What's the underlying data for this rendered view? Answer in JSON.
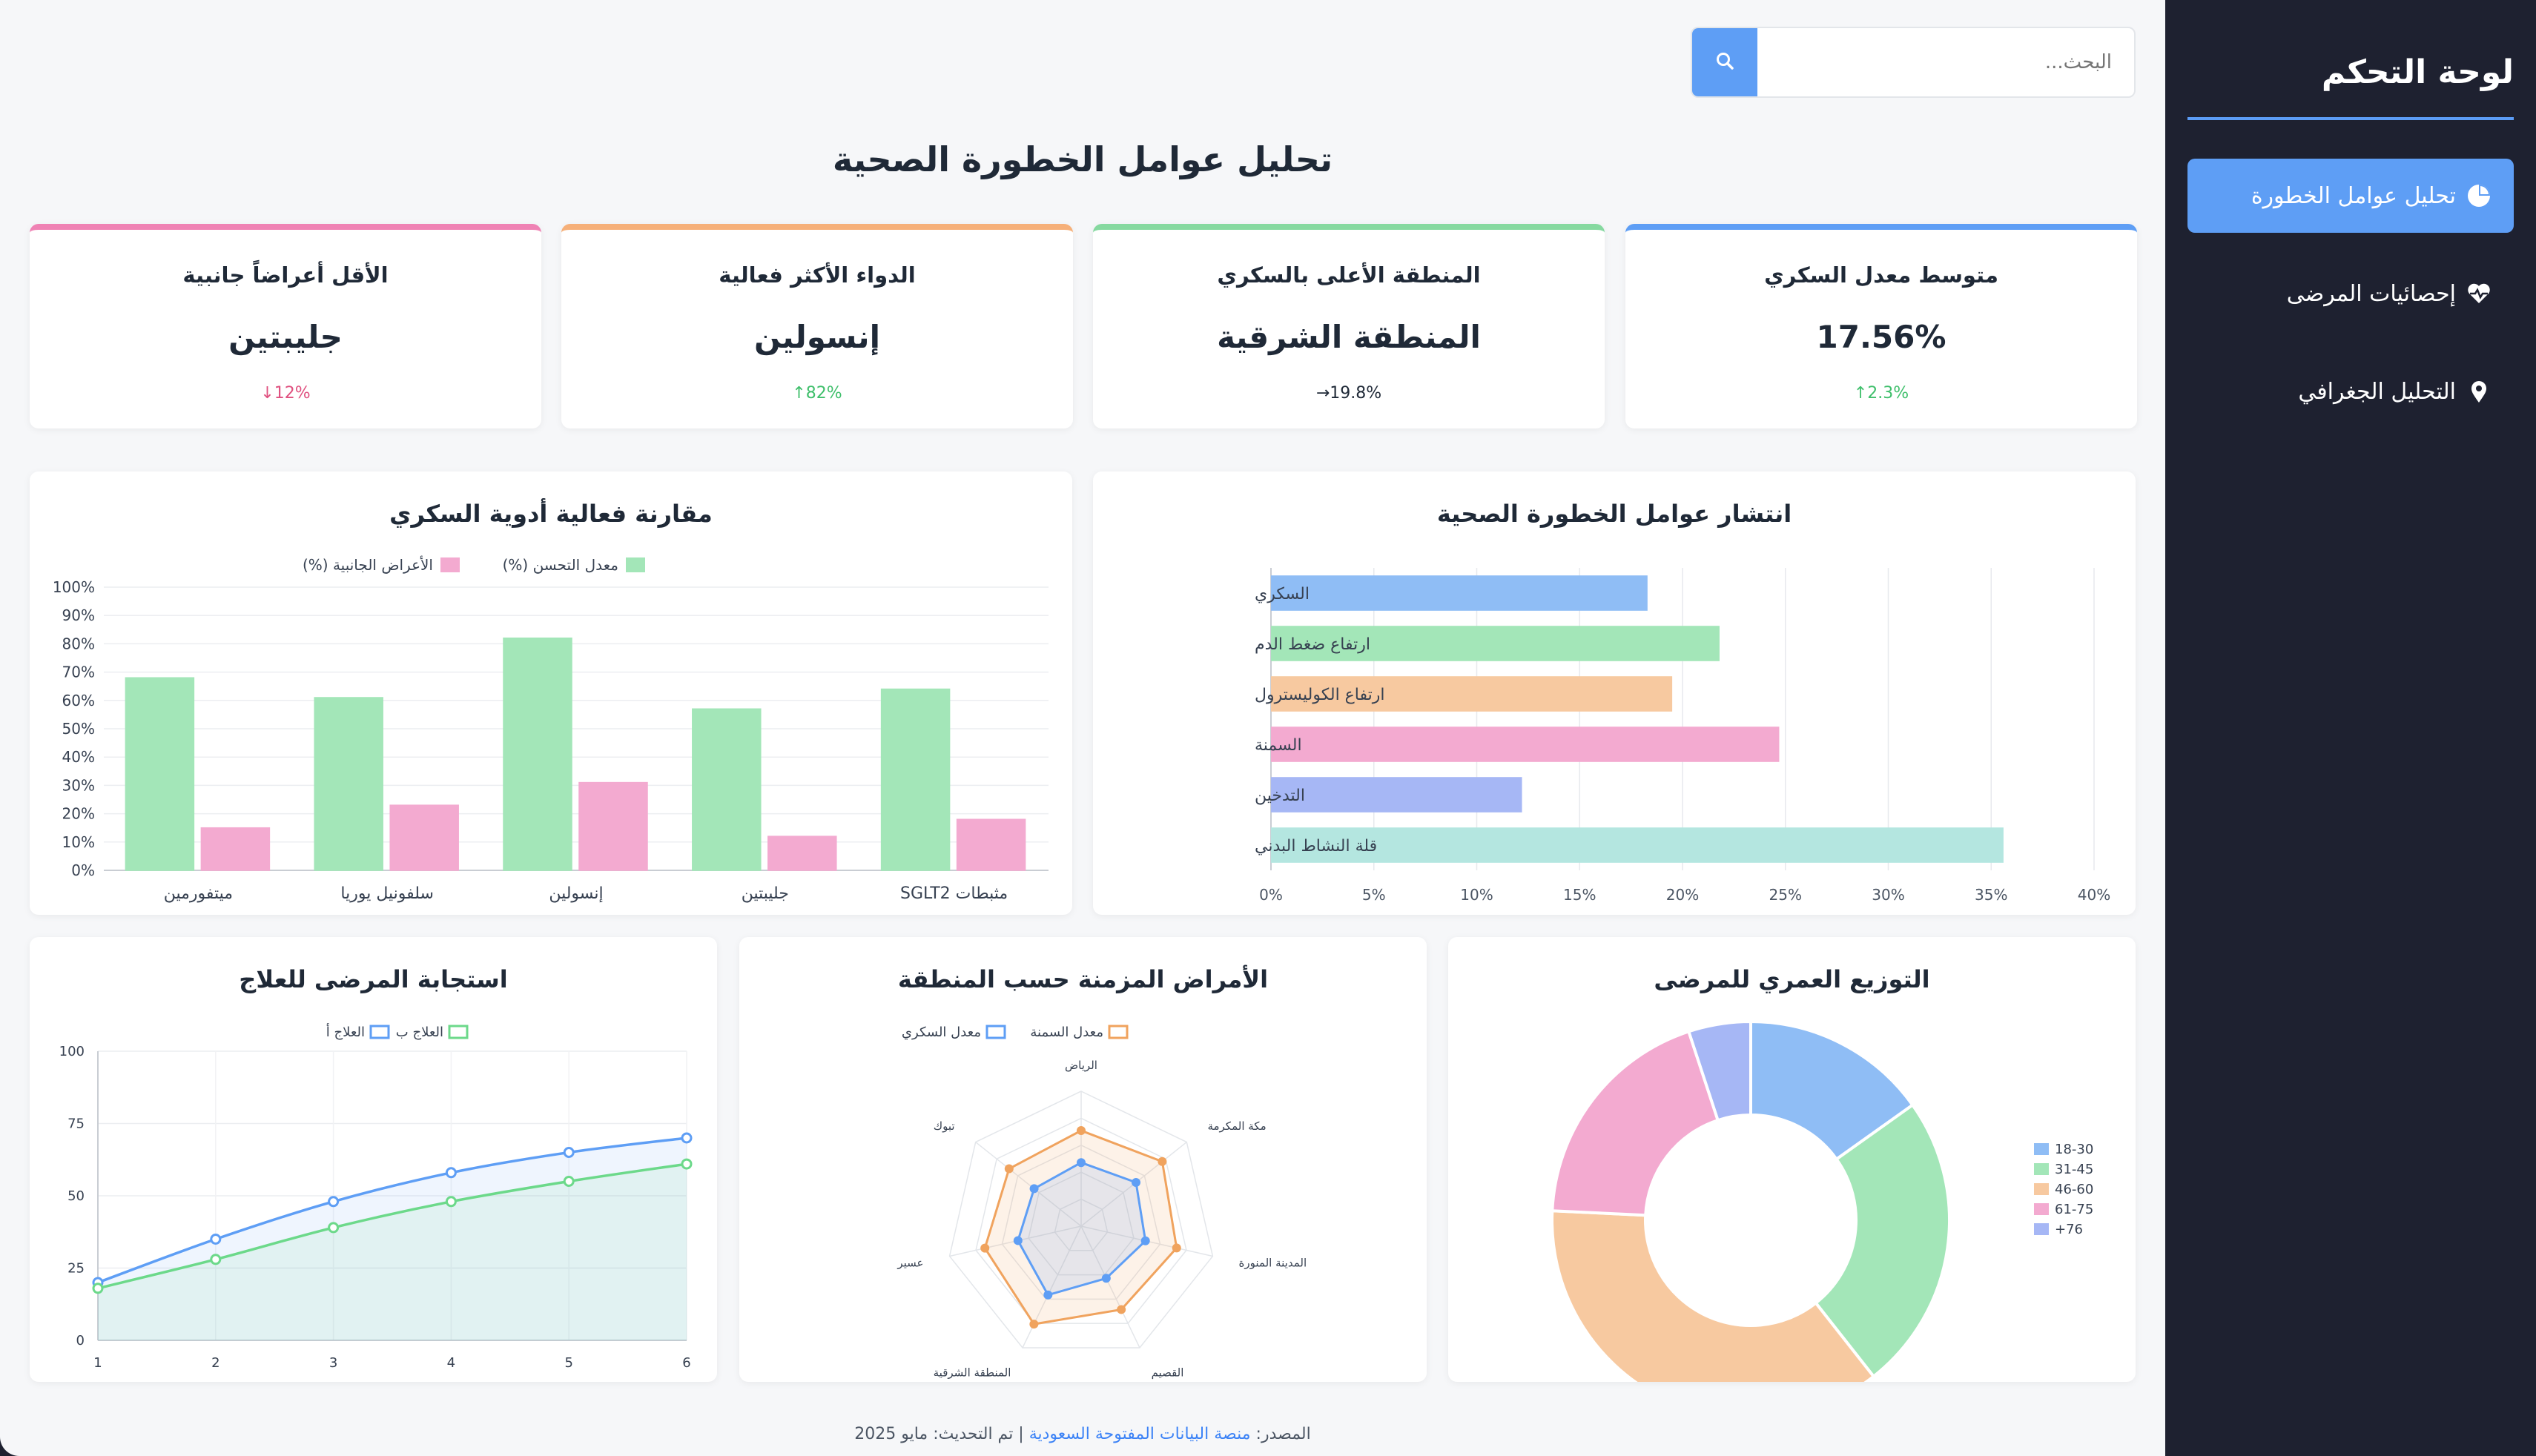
{
  "sidebar": {
    "title": "لوحة التحكم",
    "items": [
      {
        "label": "تحليل عوامل الخطورة",
        "icon": "pie-chart-icon",
        "active": true
      },
      {
        "label": "إحصائيات المرضى",
        "icon": "heartbeat-icon",
        "active": false
      },
      {
        "label": "التحليل الجغرافي",
        "icon": "map-marker-icon",
        "active": false
      }
    ]
  },
  "search": {
    "placeholder": "البحث..."
  },
  "page": {
    "title": "تحليل عوامل الخطورة الصحية"
  },
  "kpis": [
    {
      "title": "متوسط معدل السكري",
      "value": "17.56%",
      "change": "2.3%",
      "trend": "up",
      "color": "#5e9ef5",
      "trend_color": "#3fbf6b"
    },
    {
      "title": "المنطقة الأعلى بالسكري",
      "value": "المنطقة الشرقية",
      "change": "19.8%",
      "trend": "right",
      "color": "#86d9a0",
      "trend_color": "#1f2937"
    },
    {
      "title": "الدواء الأكثر فعالية",
      "value": "إنسولين",
      "change": "82%",
      "trend": "up",
      "color": "#f6b079",
      "trend_color": "#3fbf6b"
    },
    {
      "title": "الأقل أعراضاً جانبية",
      "value": "جليبتين",
      "change": "12%",
      "trend": "down",
      "color": "#ef82b4",
      "trend_color": "#e0507f"
    }
  ],
  "colors": {
    "blue": "#8fbdf5",
    "green": "#a3e6b8",
    "orange": "#f7c9a0",
    "pink": "#f3aad0",
    "indigo": "#a6b7f5",
    "teal": "#b4e6e0"
  },
  "chart_data": [
    {
      "id": "risk",
      "type": "bar",
      "orientation": "horizontal",
      "title": "انتشار عوامل الخطورة الصحية",
      "categories": [
        "السكري",
        "ارتفاع ضغط الدم",
        "ارتفاع الكوليسترول",
        "السمنة",
        "التدخين",
        "قلة النشاط البدني"
      ],
      "values": [
        18.3,
        21.8,
        19.5,
        24.7,
        12.2,
        35.6
      ],
      "bar_colors": [
        "#8fbdf5",
        "#a3e6b8",
        "#f7c9a0",
        "#f3aad0",
        "#a6b7f5",
        "#b4e6e0"
      ],
      "xlim": [
        0,
        40
      ],
      "xticks": [
        "0%",
        "5%",
        "10%",
        "15%",
        "20%",
        "25%",
        "30%",
        "35%",
        "40%"
      ],
      "grid": true
    },
    {
      "id": "drugs",
      "type": "bar",
      "title": "مقارنة فعالية أدوية السكري",
      "categories": [
        "ميتفورمين",
        "سلفونيل يوريا",
        "إنسولين",
        "جليبتين",
        "مثبطات SGLT2"
      ],
      "series": [
        {
          "name": "معدل التحسن (%)",
          "values": [
            68,
            61,
            82,
            57,
            64
          ],
          "color": "#a3e6b8"
        },
        {
          "name": "الأعراض الجانبية (%)",
          "values": [
            15,
            23,
            31,
            12,
            18
          ],
          "color": "#f3aad0"
        }
      ],
      "ylim": [
        0,
        100
      ],
      "yticks": [
        "0%",
        "10%",
        "20%",
        "30%",
        "40%",
        "50%",
        "60%",
        "70%",
        "80%",
        "90%",
        "100%"
      ],
      "legend": "top",
      "grid": true
    },
    {
      "id": "response",
      "type": "line",
      "title": "استجابة المرضى للعلاج",
      "x": [
        1,
        2,
        3,
        4,
        5,
        6
      ],
      "series": [
        {
          "name": "العلاج أ",
          "values": [
            20,
            35,
            48,
            58,
            65,
            70
          ],
          "color": "#5e9ef5"
        },
        {
          "name": "العلاج ب",
          "values": [
            18,
            28,
            39,
            48,
            55,
            61
          ],
          "color": "#6cd98a"
        }
      ],
      "ylim": [
        0,
        100
      ],
      "yticks": [
        "0",
        "25",
        "50",
        "75",
        "100"
      ],
      "legend": "top",
      "grid": true
    },
    {
      "id": "radar",
      "type": "radar",
      "title": "الأمراض المزمنة حسب المنطقة",
      "categories": [
        "الرياض",
        "مكة المكرمة",
        "المدينة المنورة",
        "القصيم",
        "المنطقة الشرقية",
        "عسير",
        "تبوك"
      ],
      "series": [
        {
          "name": "معدل السكري",
          "values": [
            16.5,
            18.2,
            17.1,
            15.0,
            19.8,
            16.8,
            15.6
          ],
          "color": "#5e9ef5"
        },
        {
          "name": "معدل السمنة",
          "values": [
            24.8,
            26.9,
            25.4,
            24.0,
            28.2,
            25.6,
            23.9
          ],
          "color": "#f0a35e"
        }
      ],
      "rlim": [
        0,
        35
      ],
      "legend": "top"
    },
    {
      "id": "age",
      "type": "pie",
      "variant": "doughnut",
      "title": "التوزيع العمري للمرضى",
      "categories": [
        "18-30",
        "31-45",
        "46-60",
        "61-75",
        "+76"
      ],
      "values": [
        15,
        24,
        36,
        19,
        5
      ],
      "slice_colors": [
        "#8fbdf5",
        "#a3e6b8",
        "#f7c9a0",
        "#f3aad0",
        "#a6b7f5"
      ],
      "legend": "right"
    }
  ],
  "footer": {
    "prefix": "المصدر:",
    "source_link": "منصة البيانات المفتوحة السعودية",
    "suffix": "| تم التحديث: مايو 2025"
  }
}
